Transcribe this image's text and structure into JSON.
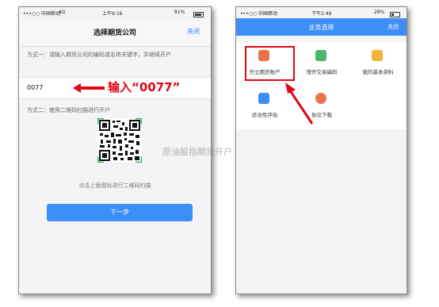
{
  "phone1": {
    "status": {
      "carrier": "•••○○ 中国移动",
      "network": "4G",
      "time": "上午9:16",
      "battery": "81%"
    },
    "nav": {
      "title": "选择期货公司",
      "close_label": "关闭"
    },
    "method1_text": "方式一：请输入期货公司的编码或名称关键字，并继续开户",
    "input_value": "0077",
    "annotation": "输入“0077”",
    "method2_text": "方式二：使用二维码扫描进行开户",
    "qr_caption": "点击上面图标进行二维码扫描",
    "next_button": "下一步"
  },
  "phone2": {
    "status": {
      "carrier": "•••○○ 中国移动",
      "time": "下午2:49",
      "battery": "28%"
    },
    "nav": {
      "title": "业务选择",
      "close_label": "关闭"
    },
    "tiles": [
      {
        "label": "开立期货账户",
        "icon": "user-add-icon",
        "color": "#e8734a"
      },
      {
        "label": "增开交易编码",
        "icon": "code-card-icon",
        "color": "#4cb867"
      },
      {
        "label": "我的基本资料",
        "icon": "profile-icon",
        "color": "#f0b43a"
      },
      {
        "label": "适当性评估",
        "icon": "assessment-icon",
        "color": "#3d8ef5"
      },
      {
        "label": "协议下载",
        "icon": "download-icon",
        "color": "#e8734a"
      }
    ]
  },
  "watermark": "原油股指期货开户",
  "colors": {
    "accent_blue": "#3d8ef5",
    "annotation_red": "#e30613"
  }
}
